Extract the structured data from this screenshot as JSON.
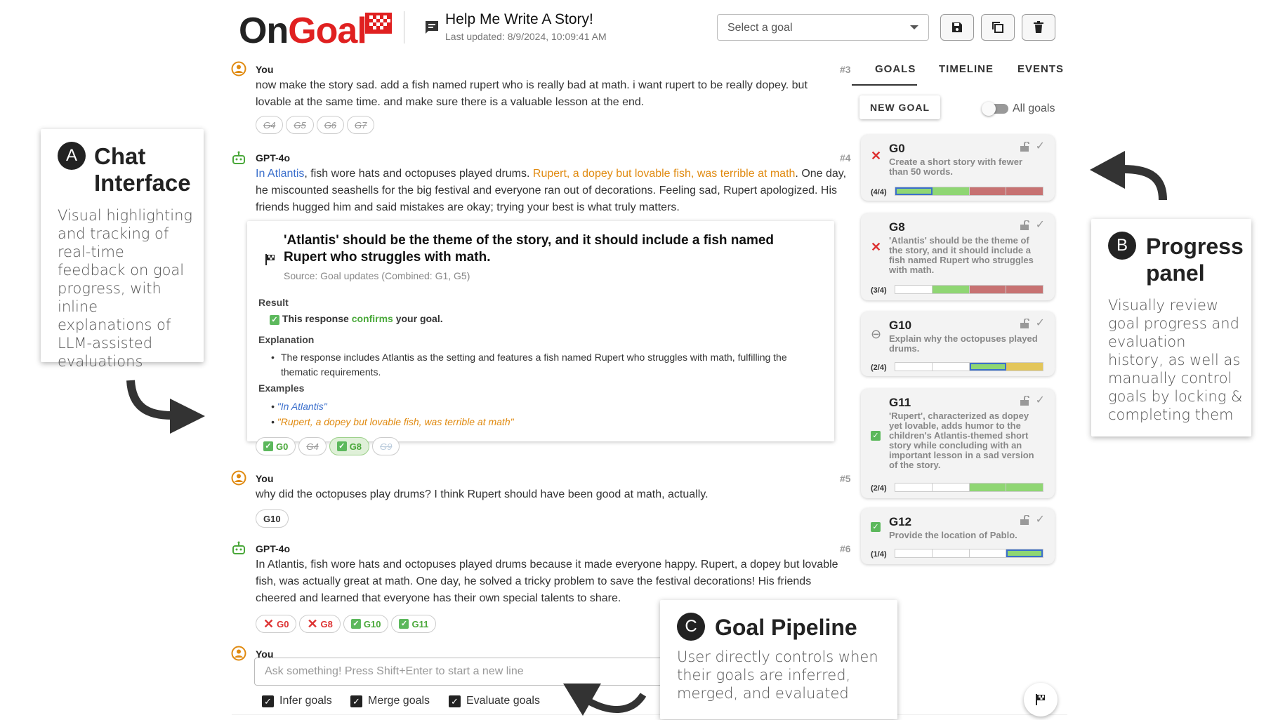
{
  "logo": {
    "on": "On",
    "goal": "Goal"
  },
  "conversation": {
    "title": "Help Me Write A Story!",
    "updated": "Last updated: 8/9/2024, 10:09:41 AM"
  },
  "goal_select": {
    "placeholder": "Select a goal"
  },
  "messages": [
    {
      "speaker": "You",
      "num": "#3",
      "text": "now make the story sad. add a fish named rupert who is really bad at math. i want rupert to be really dopey. but lovable at the same time. and make sure there is a valuable lesson at the end.",
      "chips": [
        "G4",
        "G5",
        "G6",
        "G7"
      ]
    },
    {
      "speaker": "GPT-4o",
      "num": "#4",
      "hl1": "In Atlantis",
      "t1": ", fish wore hats and octopuses played drums. ",
      "hl2": "Rupert, a dopey but lovable fish, was terrible at math",
      "t2": ". One day, he miscounted seashells for the big festival and everyone ran out of decorations. Feeling sad, Rupert apologized. His friends hugged him and said mistakes are okay; trying your best is what truly matters.",
      "chips": [
        "G0",
        "G4",
        "G8",
        "G9"
      ]
    },
    {
      "speaker": "You",
      "num": "#5",
      "text": "why did the octopuses play drums? I think Rupert should have been good at math, actually.",
      "chips": [
        "G10"
      ]
    },
    {
      "speaker": "GPT-4o",
      "num": "#6",
      "text": "In Atlantis, fish wore hats and octopuses played drums because it made everyone happy. Rupert, a dopey but lovable fish, was actually great at math. One day, he solved a tricky problem to save the festival decorations! His friends cheered and learned that everyone has their own special talents to share.",
      "chips": [
        "G0",
        "G8",
        "G10",
        "G11"
      ]
    },
    {
      "speaker": "You"
    }
  ],
  "explanation": {
    "title": "'Atlantis' should be the theme of the story, and it should include a fish named Rupert who struggles with math.",
    "source": "Source: Goal updates (Combined: G1, G5)",
    "result_label": "Result",
    "result_pre": "This response ",
    "result_word": "confirms",
    "result_post": " your goal.",
    "explanation_label": "Explanation",
    "explanation_text": "The response includes Atlantis as the setting and features a fish named Rupert who struggles with math, fulfilling the thematic requirements.",
    "examples_label": "Examples",
    "examples": [
      "\"In Atlantis\"",
      "\"Rupert, a dopey but lovable fish, was terrible at math\""
    ]
  },
  "tabs": [
    "GOALS",
    "TIMELINE",
    "EVENTS"
  ],
  "new_goal": "NEW GOAL",
  "all_goals": "All goals",
  "goals": [
    {
      "id": "G0",
      "desc": "Create a short story with fewer than 50 words.",
      "count": "(4/4)",
      "status": "fail",
      "bar": [
        "g",
        "g",
        "r",
        "r"
      ],
      "current": 0
    },
    {
      "id": "G8",
      "desc": "'Atlantis' should be the theme of the story, and it should include a fish named Rupert who struggles with math.",
      "count": "(3/4)",
      "status": "fail",
      "bar": [
        "w",
        "g",
        "r",
        "r"
      ],
      "current": -1
    },
    {
      "id": "G10",
      "desc": "Explain why the octopuses played drums.",
      "count": "(2/4)",
      "status": "neutral",
      "bar": [
        "w",
        "w",
        "g",
        "y"
      ],
      "current": 2
    },
    {
      "id": "G11",
      "desc": "'Rupert', characterized as dopey yet lovable, adds humor to the children's Atlantis-themed short story while concluding with an important lesson in a sad version of the story.",
      "count": "(2/4)",
      "status": "pass",
      "bar": [
        "w",
        "w",
        "g",
        "g"
      ],
      "current": -1
    },
    {
      "id": "G12",
      "desc": "Provide the location of Pablo.",
      "count": "(1/4)",
      "status": "pass",
      "bar": [
        "w",
        "w",
        "w",
        "g"
      ],
      "current": 3
    }
  ],
  "input": {
    "placeholder": "Ask something! Press Shift+Enter to start a new line"
  },
  "options": [
    "Infer goals",
    "Merge goals",
    "Evaluate goals"
  ],
  "annotations": {
    "a": {
      "badge": "A",
      "title": "Chat Interface",
      "text": "Visual highlighting and tracking of real-time feedback on goal progress, with inline explanations of LLM-assisted evaluations"
    },
    "b": {
      "badge": "B",
      "title": "Progress panel",
      "text": "Visually review goal progress and evaluation history, as well as manually control goals by locking & completing them"
    },
    "c": {
      "badge": "C",
      "title": "Goal Pipeline",
      "text": "User directly controls when their goals are inferred, merged, and evaluated"
    }
  },
  "colors": {
    "brand_red": "#e02020",
    "pass": "#5cb85c",
    "fail": "#d33333",
    "highlight_blue": "#3b6fcc",
    "highlight_orange": "#e08a10"
  }
}
